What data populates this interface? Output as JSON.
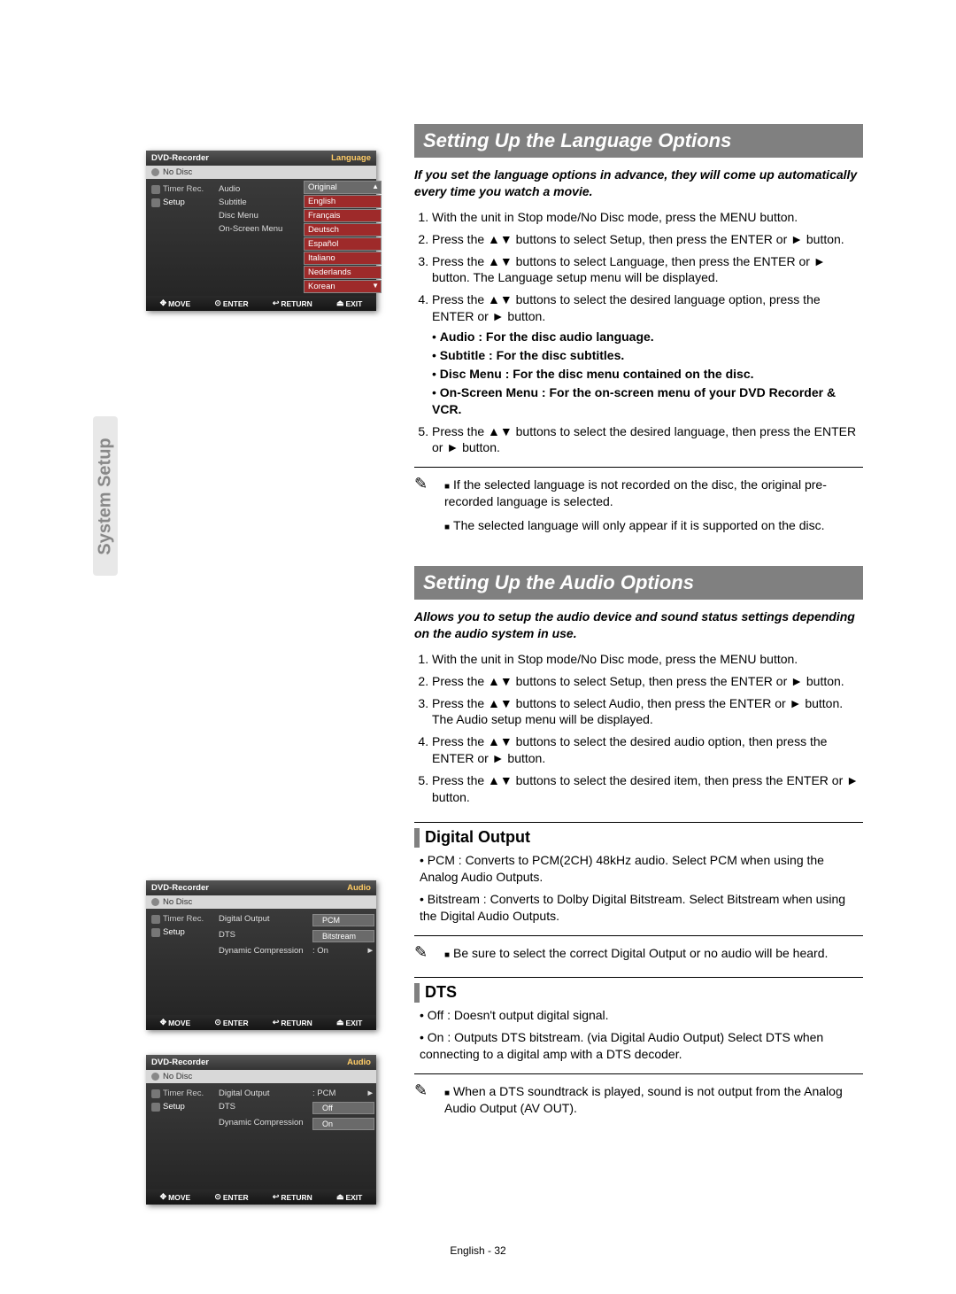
{
  "tab": "System Setup",
  "footer": "English - 32",
  "panel_common": {
    "title": "DVD-Recorder",
    "nodisc": "No Disc",
    "side_timer": "Timer Rec.",
    "side_setup": "Setup",
    "foot_move": "MOVE",
    "foot_enter": "ENTER",
    "foot_return": "RETURN",
    "foot_exit": "EXIT"
  },
  "panel1": {
    "corner": "Language",
    "opts": {
      "audio": "Audio",
      "subtitle": "Subtitle",
      "discmenu": "Disc Menu",
      "osm": "On-Screen Menu"
    },
    "langs": [
      "Original",
      "English",
      "Français",
      "Deutsch",
      "Español",
      "Italiano",
      "Nederlands",
      "Korean"
    ]
  },
  "panel2": {
    "corner": "Audio",
    "r1_lbl": "Digital Output",
    "r1_val": "PCM",
    "r2_lbl": "DTS",
    "r2_val": "Bitstream",
    "r3_lbl": "Dynamic Compression",
    "r3_val": ": On",
    "arrow": "►"
  },
  "panel3": {
    "corner": "Audio",
    "r1_lbl": "Digital Output",
    "r1_val": ": PCM",
    "r2_lbl": "DTS",
    "r2_val": "Off",
    "r3_lbl": "Dynamic Compression",
    "r3_val": "On",
    "arrow": "►"
  },
  "section1": {
    "title": "Setting Up the Language Options",
    "intro": "If you set the language options in advance, they will come up automatically every time you watch a movie.",
    "steps": {
      "s1": "With the unit in Stop mode/No Disc mode, press the MENU button.",
      "s2": "Press the  ▲▼ buttons to select Setup, then press the ENTER or ► button.",
      "s3": "Press the  ▲▼ buttons to select Language, then press the ENTER or ► button. The Language setup menu will be displayed.",
      "s4_head": "Press the  ▲▼ buttons to select the desired language option, press the ENTER or ► button.",
      "s4_a": "Audio : For the disc audio language.",
      "s4_b": "Subtitle : For the disc subtitles.",
      "s4_c": "Disc Menu : For the disc menu contained on the disc.",
      "s4_d": "On-Screen Menu : For the on-screen menu of your DVD Recorder & VCR.",
      "s5": "Press the  ▲▼ buttons to select the desired language, then press the ENTER or ► button."
    },
    "notes": {
      "n1": "If the selected language is not recorded on the disc, the original pre-recorded language is selected.",
      "n2": "The selected language will only appear if it is supported on the disc."
    }
  },
  "section2": {
    "title": "Setting Up the Audio Options",
    "intro": "Allows you to setup the audio device and sound status settings depending on the audio system in use.",
    "steps": {
      "s1": "With the unit in Stop mode/No Disc mode, press the MENU button.",
      "s2": "Press the  ▲▼ buttons to select Setup, then press the ENTER or ► button.",
      "s3": "Press the  ▲▼ buttons to select Audio, then press the ENTER or ► button. The Audio setup menu will be displayed.",
      "s4": "Press the  ▲▼ buttons to select the desired audio option, then press the ENTER or ► button.",
      "s5": "Press the  ▲▼ buttons to select the desired item, then press the ENTER or ► button."
    }
  },
  "digital_output": {
    "title": "Digital Output",
    "b1": "PCM : Converts to PCM(2CH) 48kHz audio. Select PCM when using the Analog Audio Outputs.",
    "b2": "Bitstream : Converts to Dolby Digital Bitstream. Select Bitstream when using the Digital Audio Outputs.",
    "note": "Be sure to select the correct Digital Output or no audio will be heard."
  },
  "dts": {
    "title": "DTS",
    "b1": "Off : Doesn't output digital signal.",
    "b2": "On : Outputs DTS bitstream. (via Digital Audio Output) Select DTS when connecting to a digital amp with a DTS decoder.",
    "note": "When a DTS soundtrack is played, sound is not output from the Analog Audio Output (AV OUT)."
  }
}
